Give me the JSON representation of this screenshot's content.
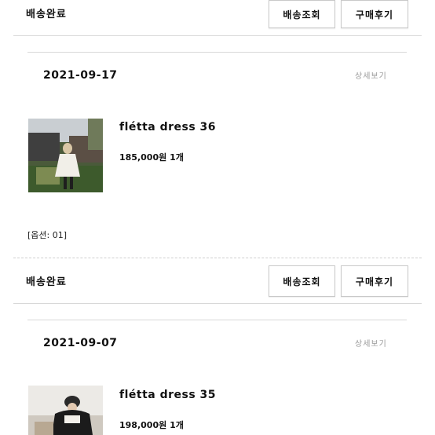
{
  "orders": [
    {
      "status": "배송완료",
      "track_button": "배송조회",
      "review_button": "구매후기",
      "date": "2021-09-17",
      "detail_link": "상세보기",
      "product_name": "flétta dress 36",
      "price": "185,000원",
      "quantity": "1개",
      "option": "[옵션: 01]"
    },
    {
      "status": "배송완료",
      "track_button": "배송조회",
      "review_button": "구매후기",
      "date": "2021-09-07",
      "detail_link": "상세보기",
      "product_name": "flétta dress 35",
      "price": "198,000원",
      "quantity": "1개"
    }
  ]
}
